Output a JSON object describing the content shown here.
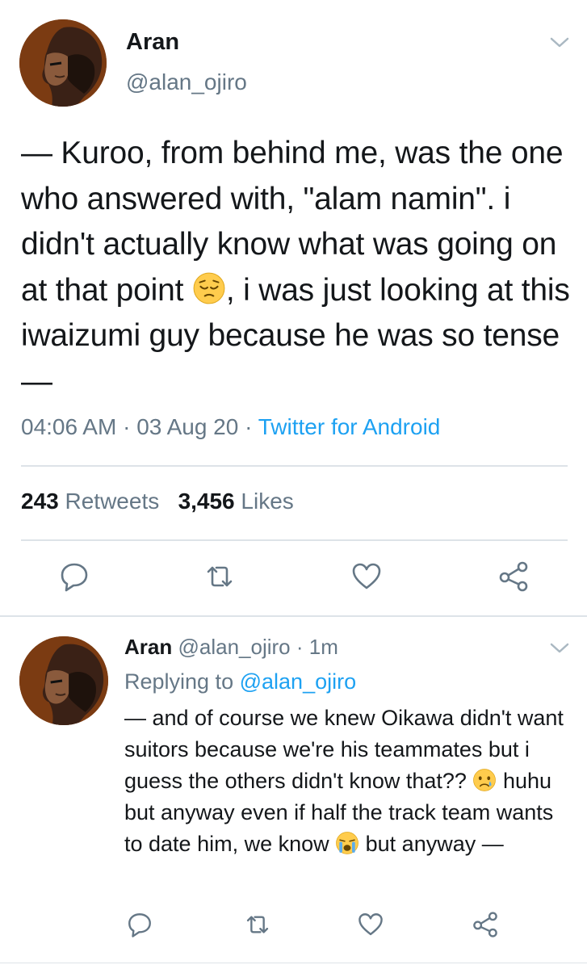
{
  "main_tweet": {
    "author_name": "Aran",
    "author_handle": "@alan_ojiro",
    "text_parts": [
      "— Kuroo, from behind me, was the one who answered with, \"alam namin\". i didn't actually know what was going on at that point ",
      ", i was just looking at this iwaizumi guy because he was so tense —"
    ],
    "emoji": "pensive-face-emoji",
    "time": "04:06 AM",
    "separator": "·",
    "date": "03 Aug 20",
    "source": "Twitter for Android",
    "retweets_count": "243",
    "retweets_label": "Retweets",
    "likes_count": "3,456",
    "likes_label": "Likes"
  },
  "reply_tweet": {
    "author_name": "Aran",
    "author_handle": "@alan_ojiro",
    "separator": "·",
    "time_ago": "1m",
    "replying_prefix": "Replying to",
    "replying_to": "@alan_ojiro",
    "text_parts": [
      "— and of course we knew Oikawa didn't want suitors because we're his teammates but i guess the others didn't know that?? ",
      " huhu but anyway even if half the track team wants to date him, we know ",
      " but anyway —"
    ],
    "emojis": [
      "crying-face-emoji",
      "loudly-crying-face-emoji"
    ]
  },
  "icons": {
    "menu": "chevron-down-icon",
    "reply": "reply-icon",
    "retweet": "retweet-icon",
    "like": "heart-icon",
    "share": "share-icon"
  },
  "colors": {
    "text": "#14171a",
    "secondary": "#657786",
    "link": "#1da1f2",
    "divider": "#dde3e8"
  }
}
